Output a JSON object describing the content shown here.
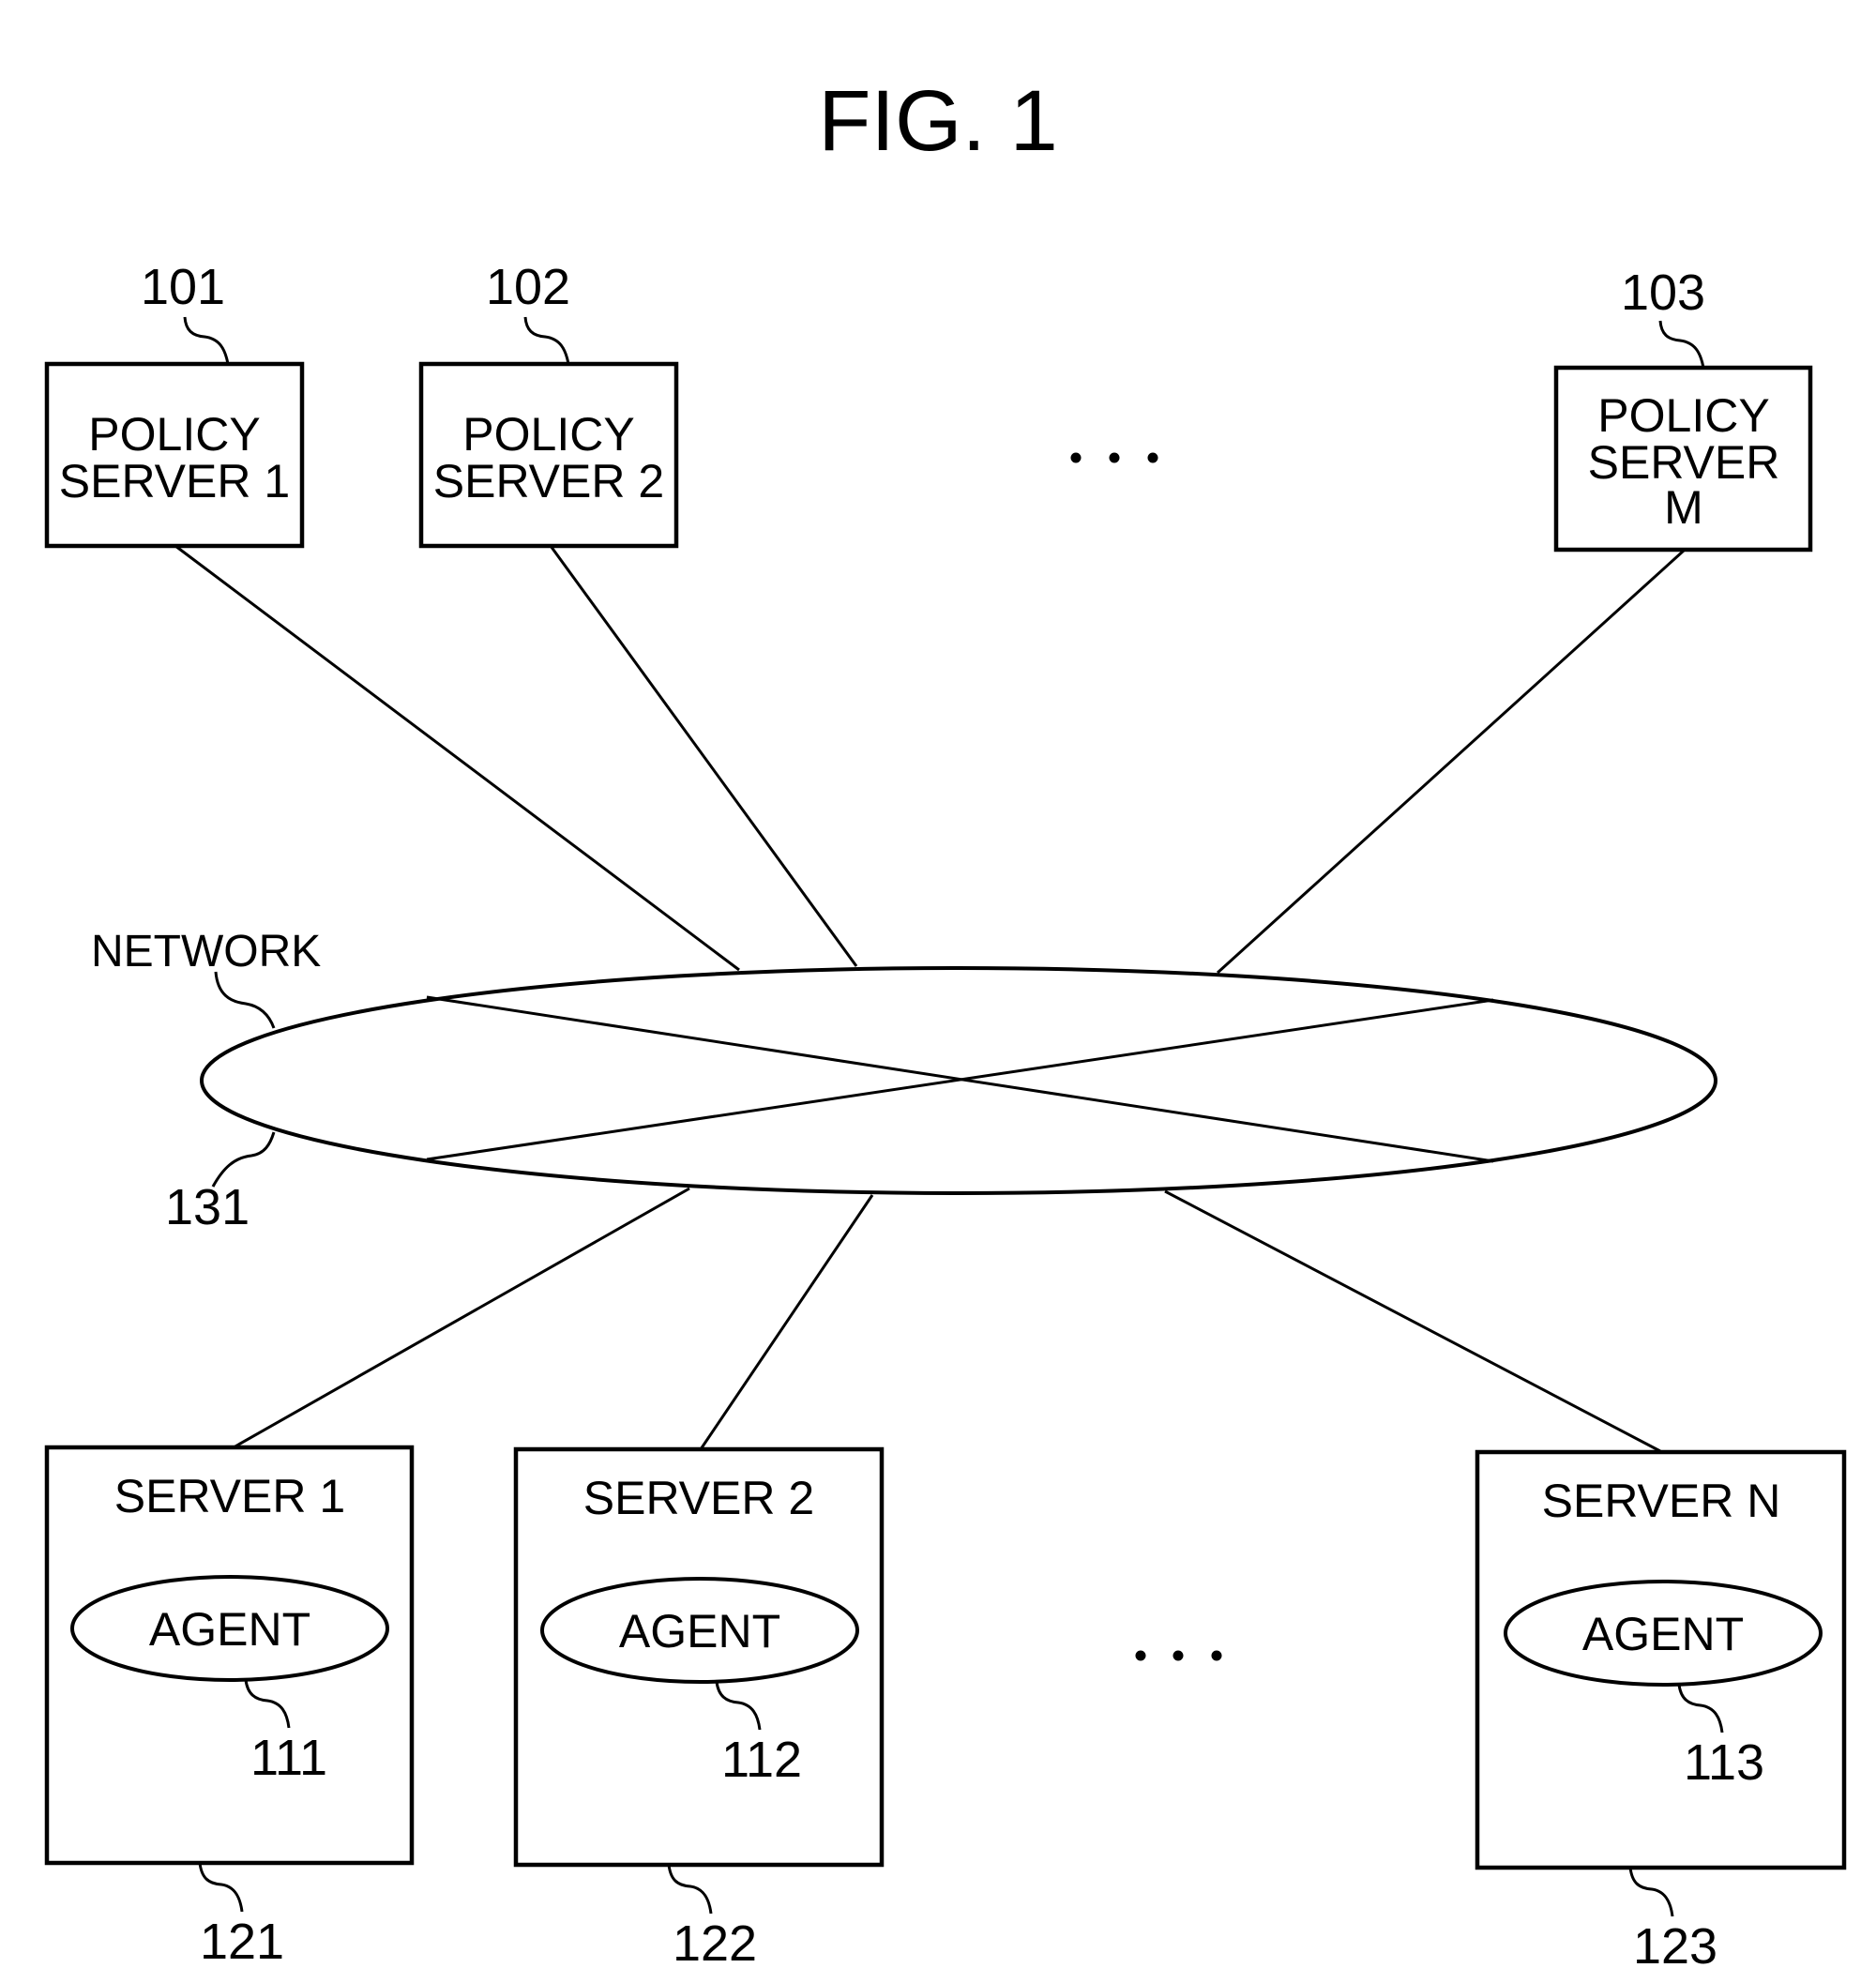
{
  "figure": {
    "title": "FIG. 1"
  },
  "policy_servers": [
    {
      "ref": "101",
      "lines": [
        "POLICY",
        "SERVER 1"
      ]
    },
    {
      "ref": "102",
      "lines": [
        "POLICY",
        "SERVER 2"
      ]
    },
    {
      "ref": "103",
      "lines": [
        "POLICY",
        "SERVER",
        "M"
      ]
    }
  ],
  "policy_servers_ellipsis": "...",
  "network": {
    "label": "NETWORK",
    "ref": "131"
  },
  "servers": [
    {
      "label": "SERVER 1",
      "ref": "121",
      "agent": {
        "label": "AGENT",
        "ref": "111"
      }
    },
    {
      "label": "SERVER 2",
      "ref": "122",
      "agent": {
        "label": "AGENT",
        "ref": "112"
      }
    },
    {
      "label": "SERVER N",
      "ref": "123",
      "agent": {
        "label": "AGENT",
        "ref": "113"
      }
    }
  ],
  "servers_ellipsis": "..."
}
